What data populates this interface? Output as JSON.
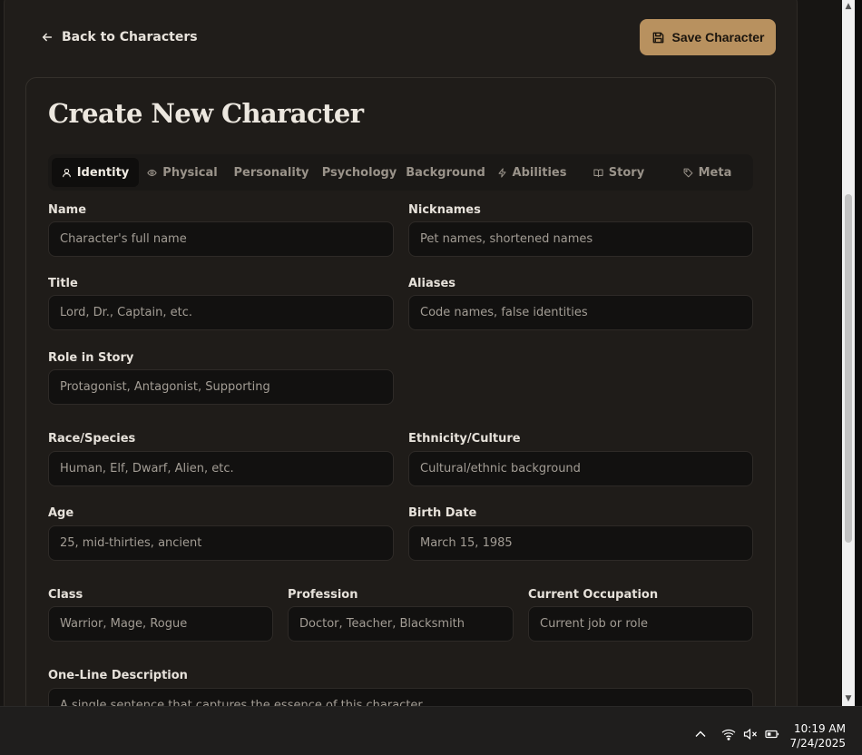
{
  "header": {
    "back_label": "Back to Characters",
    "save_label": "Save Character"
  },
  "page_title": "Create New Character",
  "tabs": [
    {
      "label": "Identity",
      "icon": "user-icon"
    },
    {
      "label": "Physical",
      "icon": "eye-icon"
    },
    {
      "label": "Personality",
      "icon": ""
    },
    {
      "label": "Psychology",
      "icon": ""
    },
    {
      "label": "Background",
      "icon": ""
    },
    {
      "label": "Abilities",
      "icon": "zap-icon"
    },
    {
      "label": "Story",
      "icon": "book-icon"
    },
    {
      "label": "Meta",
      "icon": "tag-icon"
    }
  ],
  "fields": {
    "name": {
      "label": "Name",
      "placeholder": "Character's full name"
    },
    "nicknames": {
      "label": "Nicknames",
      "placeholder": "Pet names, shortened names"
    },
    "title": {
      "label": "Title",
      "placeholder": "Lord, Dr., Captain, etc."
    },
    "aliases": {
      "label": "Aliases",
      "placeholder": "Code names, false identities"
    },
    "role": {
      "label": "Role in Story",
      "placeholder": "Protagonist, Antagonist, Supporting"
    },
    "race": {
      "label": "Race/Species",
      "placeholder": "Human, Elf, Dwarf, Alien, etc."
    },
    "ethnicity": {
      "label": "Ethnicity/Culture",
      "placeholder": "Cultural/ethnic background"
    },
    "age": {
      "label": "Age",
      "placeholder": "25, mid-thirties, ancient"
    },
    "birth_date": {
      "label": "Birth Date",
      "placeholder": "March 15, 1985"
    },
    "class": {
      "label": "Class",
      "placeholder": "Warrior, Mage, Rogue"
    },
    "profession": {
      "label": "Profession",
      "placeholder": "Doctor, Teacher, Blacksmith"
    },
    "occupation": {
      "label": "Current Occupation",
      "placeholder": "Current job or role"
    },
    "one_line": {
      "label": "One-Line Description",
      "placeholder": "A single sentence that captures the essence of this character"
    }
  },
  "taskbar": {
    "time": "10:19 AM",
    "date": "7/24/2025"
  },
  "colors": {
    "accent": "#b8915f",
    "background": "#171513",
    "card": "#1f1c19",
    "input": "#121110"
  }
}
